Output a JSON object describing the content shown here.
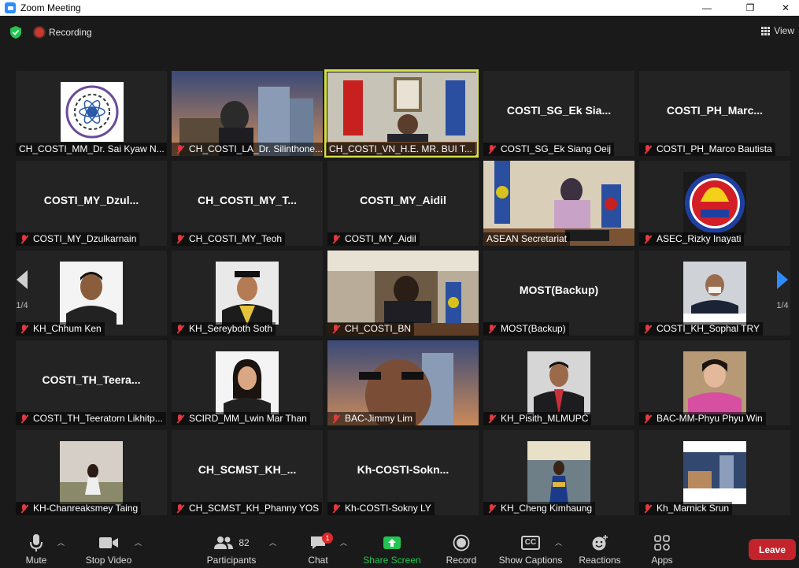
{
  "window": {
    "title": "Zoom Meeting",
    "minimize": "—",
    "maximize": "❐",
    "close": "✕"
  },
  "topbar": {
    "recording": "Recording",
    "view": "View"
  },
  "nav": {
    "page_left": "1/4",
    "page_right": "1/4"
  },
  "tiles": [
    {
      "label": "CH_COSTI_MM_Dr. Sai Kyaw N...",
      "big": "",
      "muted": false
    },
    {
      "label": "CH_COSTI_LA_Dr. Silinthone...",
      "big": "",
      "muted": true
    },
    {
      "label": "CH_COSTI_VN_H.E. MR. BUI T...",
      "big": "",
      "muted": false
    },
    {
      "label": "COSTI_SG_Ek Siang Oeij",
      "big": "COSTI_SG_Ek  Sia...",
      "muted": true
    },
    {
      "label": "COSTI_PH_Marco Bautista",
      "big": "COSTI_PH_Marc...",
      "muted": true
    },
    {
      "label": "COSTI_MY_Dzulkarnain",
      "big": "COSTI_MY_Dzul...",
      "muted": true
    },
    {
      "label": "CH_COSTI_MY_Teoh",
      "big": "CH_COSTI_MY_T...",
      "muted": true
    },
    {
      "label": "COSTI_MY_Aidil",
      "big": "COSTI_MY_Aidil",
      "muted": true
    },
    {
      "label": "ASEAN Secretariat",
      "big": "",
      "muted": false
    },
    {
      "label": "ASEC_Rizky Inayati",
      "big": "",
      "muted": true
    },
    {
      "label": "KH_Chhum Ken",
      "big": "",
      "muted": true
    },
    {
      "label": "KH_Sereyboth Soth",
      "big": "",
      "muted": true
    },
    {
      "label": "CH_COSTI_BN",
      "big": "",
      "muted": true
    },
    {
      "label": "MOST(Backup)",
      "big": "MOST(Backup)",
      "muted": true
    },
    {
      "label": "COSTI_KH_Sophal TRY",
      "big": "",
      "muted": true
    },
    {
      "label": "COSTI_TH_Teeratorn Likhitp...",
      "big": "COSTI_TH_Teera...",
      "muted": true
    },
    {
      "label": "SCIRD_MM_Lwin Mar Than",
      "big": "",
      "muted": true
    },
    {
      "label": "BAC-Jimmy Lim",
      "big": "",
      "muted": true
    },
    {
      "label": "KH_Pisith_MLMUPC",
      "big": "",
      "muted": true
    },
    {
      "label": "BAC-MM-Phyu Phyu Win",
      "big": "",
      "muted": true
    },
    {
      "label": "KH-Chanreaksmey Taing",
      "big": "",
      "muted": true
    },
    {
      "label": "CH_SCMST_KH_Phanny YOS",
      "big": "CH_SCMST_KH_...",
      "muted": true
    },
    {
      "label": "Kh-COSTI-Sokny LY",
      "big": "Kh-COSTI-Sokn...",
      "muted": true
    },
    {
      "label": "KH_Cheng Kimhaung",
      "big": "",
      "muted": true
    },
    {
      "label": "Kh_Marnick Srun",
      "big": "",
      "muted": true
    }
  ],
  "toolbar": {
    "mute": "Mute",
    "stop_video": "Stop Video",
    "participants": "Participants",
    "participants_count": "82",
    "chat": "Chat",
    "chat_badge": "1",
    "share_screen": "Share Screen",
    "record": "Record",
    "show_captions": "Show Captions",
    "cc": "CC",
    "reactions": "Reactions",
    "apps": "Apps",
    "leave": "Leave"
  },
  "colors": {
    "active_speaker": "#d7e043",
    "share_green": "#23c552",
    "leave_red": "#c5232b",
    "muted_red": "#e0393e"
  }
}
